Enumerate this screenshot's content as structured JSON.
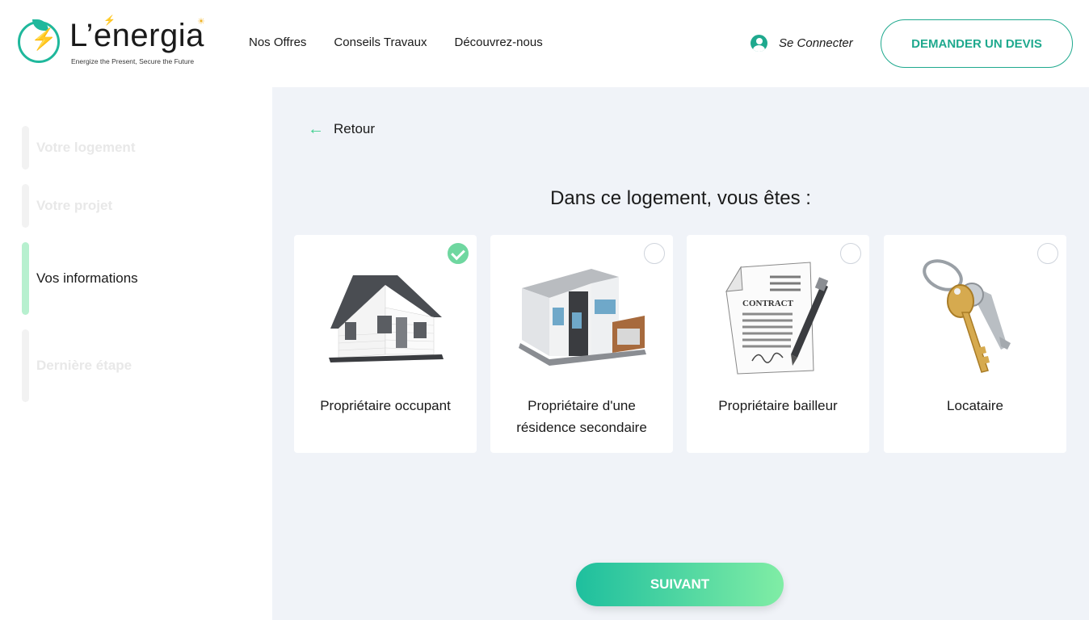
{
  "brand": {
    "name": "L’energia",
    "tagline": "Energize the Present, Secure the Future"
  },
  "nav": {
    "items": [
      "Nos Offres",
      "Conseils Travaux",
      "Découvrez-nous"
    ]
  },
  "header": {
    "login_label": "Se Connecter",
    "cta_label": "DEMANDER UN DEVIS"
  },
  "sidebar": {
    "steps": [
      {
        "label": "Votre logement",
        "state": "inactive"
      },
      {
        "label": "Votre projet",
        "state": "inactive"
      },
      {
        "label": "Vos informations",
        "state": "active"
      },
      {
        "label": "Dernière étape",
        "state": "inactive"
      }
    ]
  },
  "main": {
    "back_label": "Retour",
    "question": "Dans ce logement, vous êtes :",
    "options": [
      {
        "label": "Propriétaire occupant",
        "selected": true,
        "icon": "house-icon"
      },
      {
        "label": "Propriétaire d'une résidence secondaire",
        "selected": false,
        "icon": "modern-house-icon"
      },
      {
        "label": "Propriétaire bailleur",
        "selected": false,
        "icon": "contract-icon"
      },
      {
        "label": "Locataire",
        "selected": false,
        "icon": "keys-icon"
      }
    ],
    "contract_word": "CONTRACT",
    "next_label": "SUIVANT"
  },
  "colors": {
    "accent": "#1fa98e",
    "active_step": "#b7f0cf",
    "check": "#6fd7a0",
    "panel_bg": "#f0f3f8"
  }
}
